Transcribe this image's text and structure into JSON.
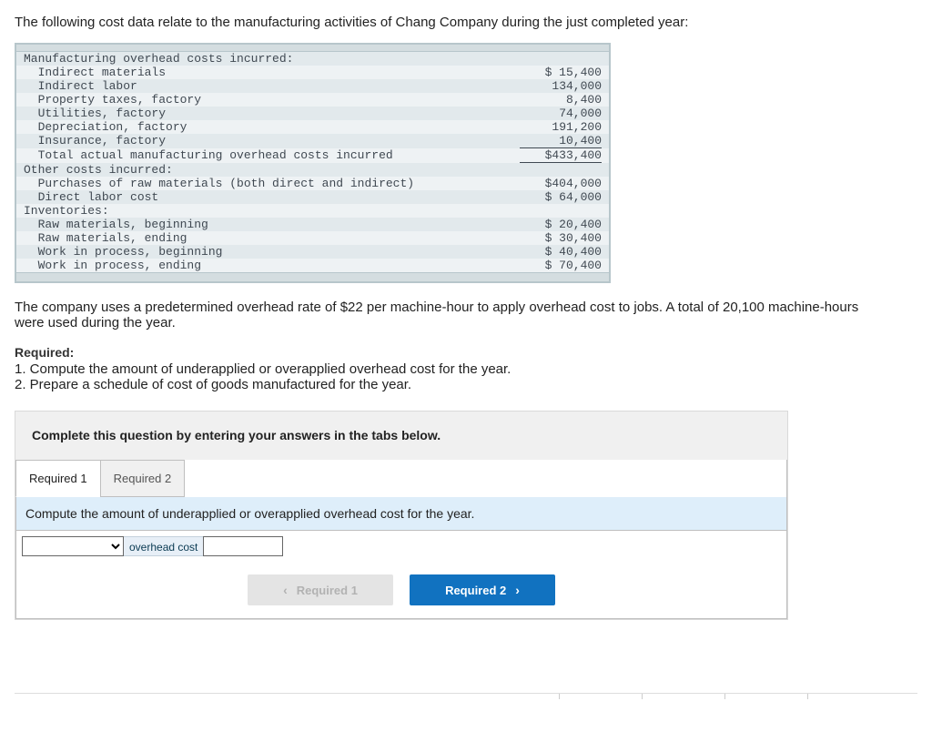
{
  "intro": "The following cost data relate to the manufacturing activities of Chang Company during the just completed year:",
  "cost": {
    "headings": {
      "moh": "Manufacturing overhead costs incurred:",
      "other": "Other costs incurred:",
      "inv": "Inventories:"
    },
    "moh_items": [
      {
        "label": "  Indirect materials",
        "value": "$ 15,400"
      },
      {
        "label": "  Indirect labor",
        "value": "134,000"
      },
      {
        "label": "  Property taxes, factory",
        "value": "8,400"
      },
      {
        "label": "  Utilities, factory",
        "value": "74,000"
      },
      {
        "label": "  Depreciation, factory",
        "value": "191,200"
      },
      {
        "label": "  Insurance, factory",
        "value": "10,400"
      }
    ],
    "moh_total": {
      "label": "  Total actual manufacturing overhead costs incurred",
      "value": "$433,400"
    },
    "other_items": [
      {
        "label": "  Purchases of raw materials (both direct and indirect)",
        "value": "$404,000"
      },
      {
        "label": "  Direct labor cost",
        "value": "$ 64,000"
      }
    ],
    "inv_items": [
      {
        "label": "  Raw materials, beginning",
        "value": "$ 20,400"
      },
      {
        "label": "  Raw materials, ending",
        "value": "$ 30,400"
      },
      {
        "label": "  Work in process, beginning",
        "value": "$ 40,400"
      },
      {
        "label": "  Work in process, ending",
        "value": "$ 70,400"
      }
    ]
  },
  "narrative": "The company uses a predetermined overhead rate of $22 per machine-hour to apply overhead cost to jobs. A total of 20,100 machine-hours were used during the year.",
  "required": {
    "title": "Required:",
    "r1": "1. Compute the amount of underapplied or overapplied overhead cost for the year.",
    "r2": "2. Prepare a schedule of cost of goods manufactured for the year."
  },
  "answer": {
    "instruction": "Complete this question by entering your answers in the tabs below.",
    "tabs": [
      "Required 1",
      "Required 2"
    ],
    "prompt": "Compute the amount of underapplied or overapplied overhead cost for the year.",
    "inline_label": "overhead cost",
    "nav_prev": "Required 1",
    "nav_next": "Required 2"
  }
}
